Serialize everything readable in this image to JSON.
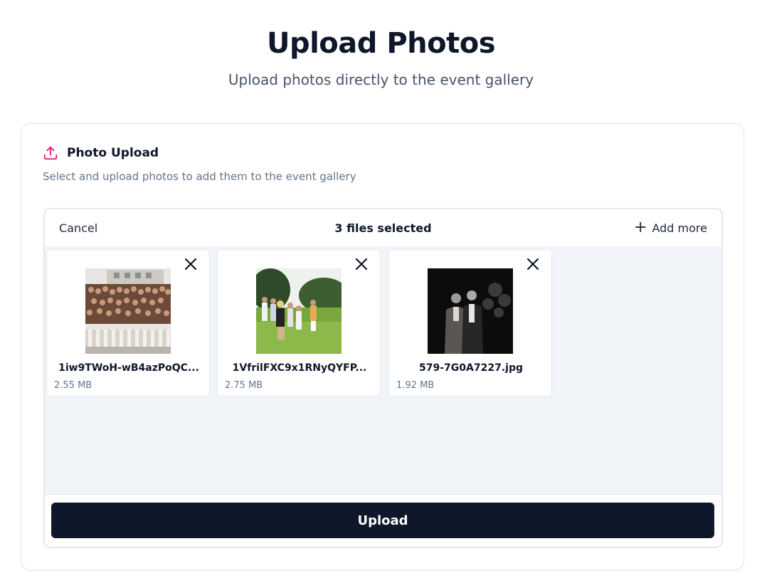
{
  "page": {
    "title": "Upload Photos",
    "subtitle": "Upload photos directly to the event gallery"
  },
  "card": {
    "icon": "upload-icon",
    "title": "Photo Upload",
    "description": "Select and upload photos to add them to the event gallery",
    "accent_color": "#e11d74"
  },
  "dashboard": {
    "cancel_label": "Cancel",
    "files_selected_label": "3 files selected",
    "add_more_label": "Add more",
    "add_more_icon": "plus-icon",
    "upload_label": "Upload",
    "upload_button_color": "#0f172a",
    "files": [
      {
        "name": "1iw9TWoH-wB4azPoQC...",
        "size": "2.55 MB",
        "thumbnail": "group-photo-on-balcony"
      },
      {
        "name": "1VfrilFXC9x1RNyQYFP...",
        "size": "2.75 MB",
        "thumbnail": "group-on-lawn"
      },
      {
        "name": "579-7G0A7227.jpg",
        "size": "1.92 MB",
        "thumbnail": "two-men-at-night"
      }
    ]
  }
}
